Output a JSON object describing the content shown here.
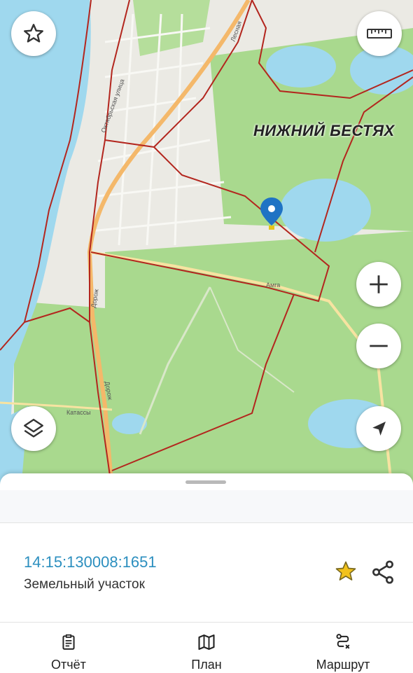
{
  "map": {
    "place_label": "НИЖНИЙ БЕСТЯХ",
    "street_labels": [
      "Октябрьская улица",
      "Лесная",
      "Амга",
      "Дорож",
      "Дорож",
      "Катассы"
    ],
    "colors": {
      "water": "#9fd8ee",
      "forest": "#a8d98c",
      "urban": "#e9e8e2",
      "boundary": "#b3261e",
      "marker": "#1f73c4"
    }
  },
  "controls": {
    "favorite_icon": "star-outline-icon",
    "ruler_icon": "ruler-icon",
    "zoom_in_icon": "plus-icon",
    "zoom_out_icon": "minus-icon",
    "layers_icon": "layers-icon",
    "locate_icon": "navigation-arrow-icon"
  },
  "parcel": {
    "cadastral_number": "14:15:130008:1651",
    "type": "Земельный участок",
    "favorite_color": "#f2c21b"
  },
  "tabs": [
    {
      "label": "Отчёт",
      "icon": "report-icon"
    },
    {
      "label": "План",
      "icon": "map-icon"
    },
    {
      "label": "Маршрут",
      "icon": "route-icon"
    }
  ]
}
